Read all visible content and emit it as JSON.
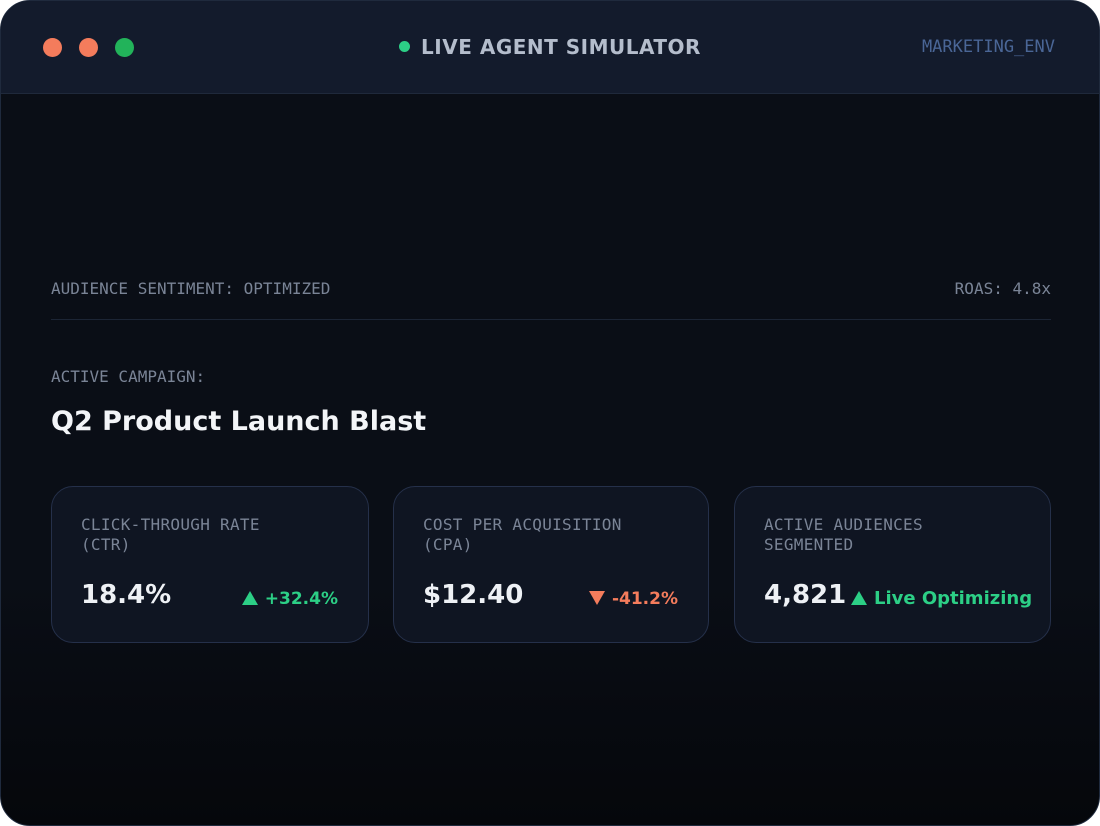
{
  "window": {
    "title": "LIVE AGENT SIMULATOR",
    "environment": "MARKETING_ENV",
    "controls": [
      "close",
      "minimize",
      "maximize"
    ]
  },
  "colors": {
    "close": "#f47c5c",
    "minimize": "#f47c5c",
    "maximize": "#22b35a",
    "live_indicator": "#2ccf86",
    "environment_text": "#4a6696",
    "positive": "#2ccf86",
    "negative": "#f47c5c"
  },
  "status": {
    "sentiment": "AUDIENCE SENTIMENT: OPTIMIZED",
    "roas": "ROAS: 4.8x"
  },
  "campaign": {
    "label": "ACTIVE CAMPAIGN:",
    "name": "Q2 Product Launch Blast"
  },
  "metrics": [
    {
      "label_line1": "CLICK-THROUGH RATE",
      "label_line2": "(CTR)",
      "value": "18.4%",
      "delta": "+32.4%",
      "direction": "up",
      "icon": "triangle-up-icon"
    },
    {
      "label_line1": "COST PER ACQUISITION",
      "label_line2": "(CPA)",
      "value": "$12.40",
      "delta": "-41.2%",
      "direction": "down",
      "icon": "triangle-down-icon"
    },
    {
      "label_line1": "ACTIVE AUDIENCES",
      "label_line2": "SEGMENTED",
      "value": "4,821",
      "delta": "Live Optimizing",
      "direction": "up",
      "icon": "triangle-up-icon"
    }
  ]
}
